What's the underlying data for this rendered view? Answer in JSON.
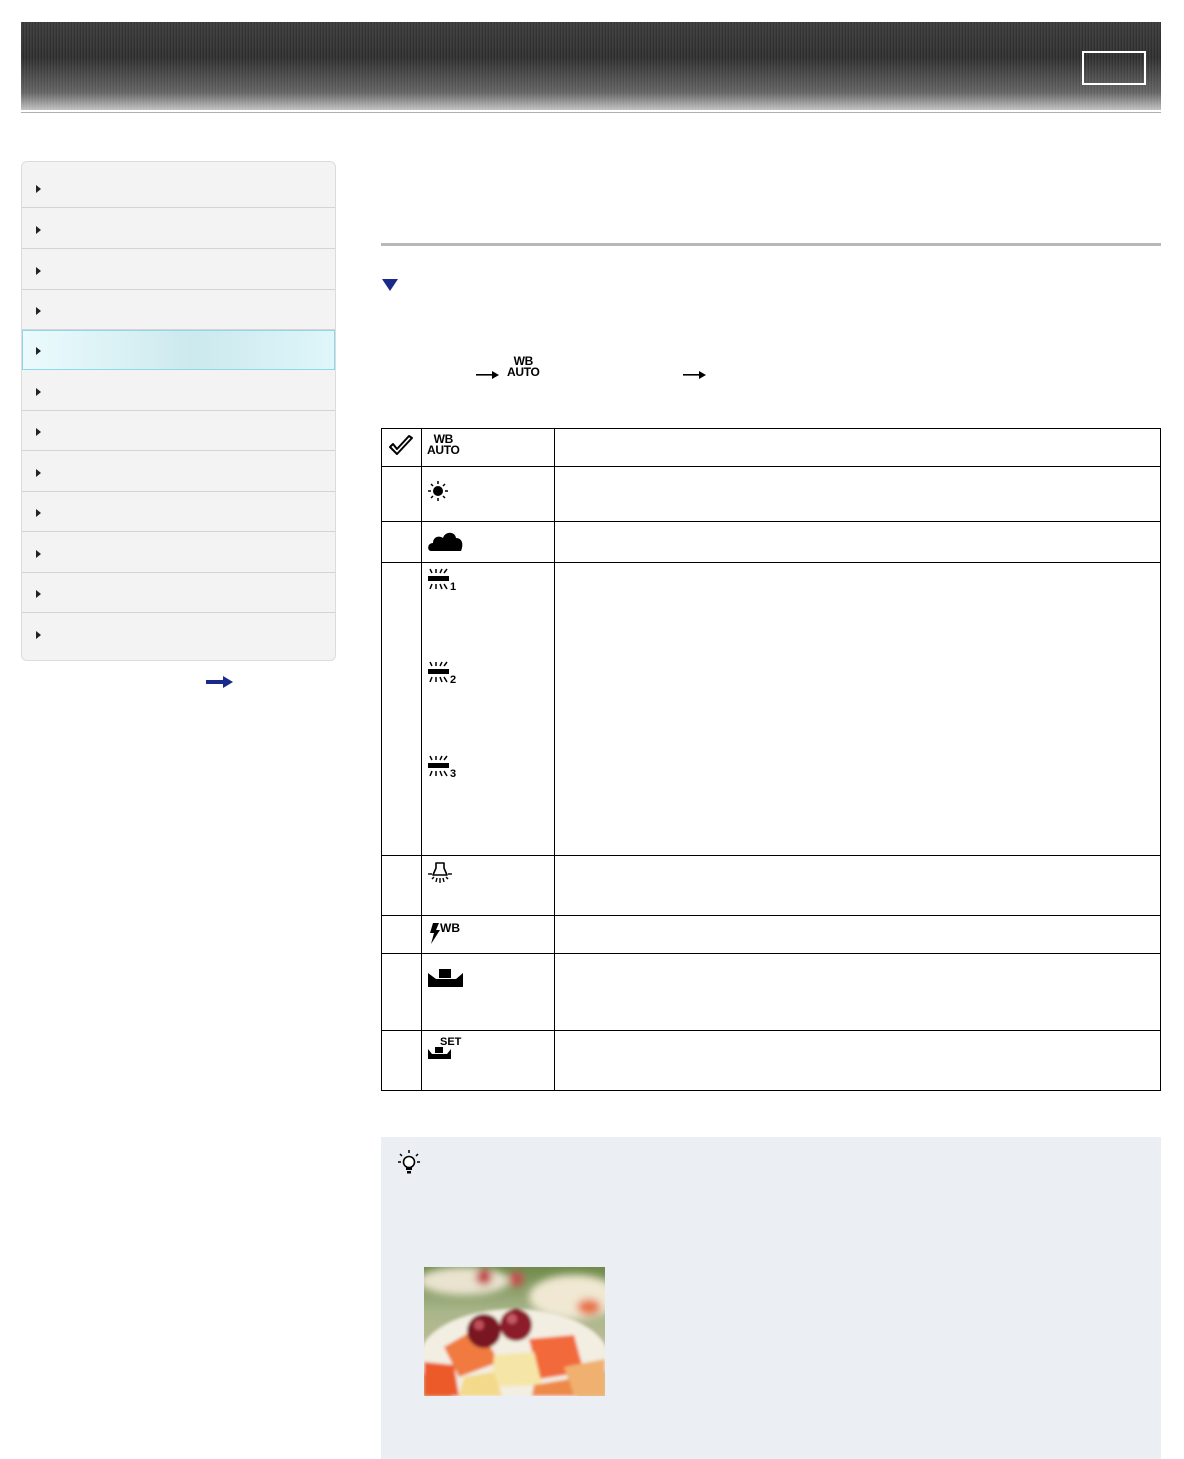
{
  "header": {
    "button_label": ""
  },
  "sidebar": {
    "items": [
      {
        "label": ""
      },
      {
        "label": ""
      },
      {
        "label": ""
      },
      {
        "label": ""
      },
      {
        "label": "",
        "active": true
      },
      {
        "label": ""
      },
      {
        "label": ""
      },
      {
        "label": ""
      },
      {
        "label": ""
      },
      {
        "label": ""
      },
      {
        "label": ""
      },
      {
        "label": ""
      }
    ],
    "more_link_icon": "right-arrow-icon"
  },
  "content": {
    "section_marker_icon": "down-triangle-icon",
    "menu_path": [
      "arrow-icon",
      "wb-auto-icon",
      "arrow-icon"
    ],
    "wb_auto_label_top": "WB",
    "wb_auto_label_bottom": "AUTO"
  },
  "table": {
    "rows": [
      {
        "selected": true,
        "icon": "wb-auto-icon",
        "icon_top": "WB",
        "icon_bottom": "AUTO"
      },
      {
        "selected": false,
        "icon": "daylight-sun-icon"
      },
      {
        "selected": false,
        "icon": "cloudy-icon"
      },
      {
        "selected": false,
        "icons": [
          {
            "icon": "fluorescent-1-icon",
            "number": "1"
          },
          {
            "icon": "fluorescent-2-icon",
            "number": "2"
          },
          {
            "icon": "fluorescent-3-icon",
            "number": "3"
          }
        ]
      },
      {
        "selected": false,
        "icon": "incandescent-bulb-icon"
      },
      {
        "selected": false,
        "icon": "flash-wb-icon",
        "icon_text": "WB"
      },
      {
        "selected": false,
        "icon": "one-push-icon"
      },
      {
        "selected": false,
        "icon": "one-push-set-icon",
        "icon_text": "SET"
      }
    ]
  },
  "hint": {
    "icon": "lightbulb-hint-icon",
    "image": "fruit-photo"
  },
  "colors": {
    "accent": "#1a2a8a",
    "active_nav": "#cce9ee",
    "hint_bg": "#ebeef3"
  }
}
